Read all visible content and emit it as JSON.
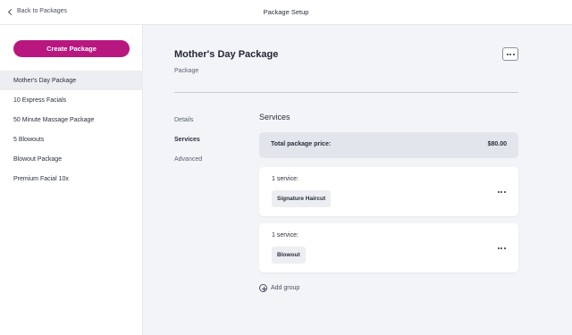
{
  "header": {
    "back_label": "Back to Packages",
    "title": "Package Setup"
  },
  "sidebar": {
    "create_label": "Create Package",
    "items": [
      {
        "label": "Mother's Day Package"
      },
      {
        "label": "10 Express Facials"
      },
      {
        "label": "50 Minute Massage Package"
      },
      {
        "label": "5 Blowouts"
      },
      {
        "label": "Blowout Package"
      },
      {
        "label": "Premium Facial 10x"
      }
    ]
  },
  "main": {
    "title": "Mother's Day Package",
    "subtitle": "Package",
    "tabs": [
      {
        "label": "Details"
      },
      {
        "label": "Services"
      },
      {
        "label": "Advanced"
      }
    ],
    "services": {
      "heading": "Services",
      "total_label": "Total package price:",
      "total_value": "$80.00",
      "groups": [
        {
          "count_label": "1 service:",
          "service": "Signature Haircut"
        },
        {
          "count_label": "1 service:",
          "service": "Blowout"
        }
      ],
      "add_group_label": "Add group"
    }
  },
  "colors": {
    "accent": "#b8177f",
    "background": "#f3f4f7",
    "active_item": "#eceef2"
  },
  "icons": {
    "back": "chevron-left-icon",
    "more": "ellipsis-icon",
    "add": "plus-circle-icon"
  }
}
